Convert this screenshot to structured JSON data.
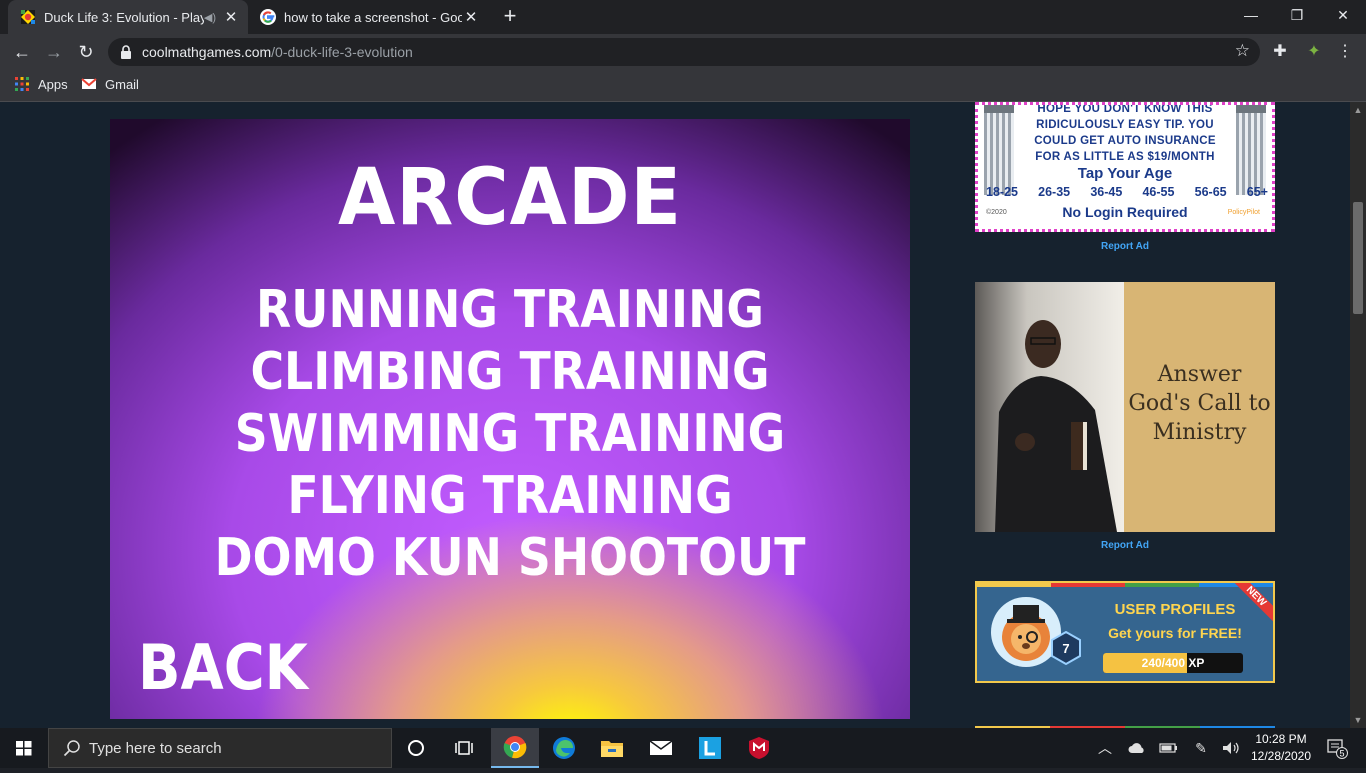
{
  "browser": {
    "tabs": [
      {
        "title": "Duck Life 3: Evolution - Play",
        "active": true
      },
      {
        "title": "how to take a screenshot - Goog",
        "active": false
      }
    ],
    "url_host": "coolmathgames.com",
    "url_path": "/0-duck-life-3-evolution",
    "bookmarks": [
      {
        "label": "Apps",
        "icon": "apps-grid-icon"
      },
      {
        "label": "Gmail",
        "icon": "gmail-icon"
      }
    ]
  },
  "game": {
    "heading": "ARCADE",
    "menu": [
      "RUNNING TRAINING",
      "CLIMBING TRAINING",
      "SWIMMING TRAINING",
      "FLYING TRAINING",
      "DOMO KUN SHOOTOUT"
    ],
    "back_label": "BACK"
  },
  "ads": {
    "insurance": {
      "lines": [
        "HOPE YOU DON'T KNOW THIS",
        "RIDICULOUSLY EASY TIP. YOU",
        "COULD GET AUTO INSURANCE",
        "FOR AS LITTLE AS $19/MONTH"
      ],
      "tap": "Tap Your Age",
      "ages": [
        "18-25",
        "26-35",
        "36-45",
        "46-55",
        "56-65",
        "65+"
      ],
      "no_login": "No Login Required",
      "copyright": "©2020",
      "brand": "PolicyPilot"
    },
    "report_label": "Report Ad",
    "ministry": {
      "lines": [
        "Answer",
        "God's Call to",
        "Ministry"
      ]
    },
    "profiles": {
      "title": "USER PROFILES",
      "subtitle": "Get yours for FREE!",
      "xp_text": "240/400 XP",
      "xp_fraction": 0.6,
      "level": "7",
      "badge": "NEW"
    }
  },
  "taskbar": {
    "search_placeholder": "Type here to search",
    "time": "10:28 PM",
    "date": "12/28/2020",
    "notification_count": "5"
  },
  "colors": {
    "chrome_dark": "#202124",
    "chrome_toolbar": "#35363a",
    "page_bg": "#16222e",
    "game_purple": "#c25cff",
    "game_yellow": "#ffff00",
    "report_link": "#42a5f5"
  }
}
